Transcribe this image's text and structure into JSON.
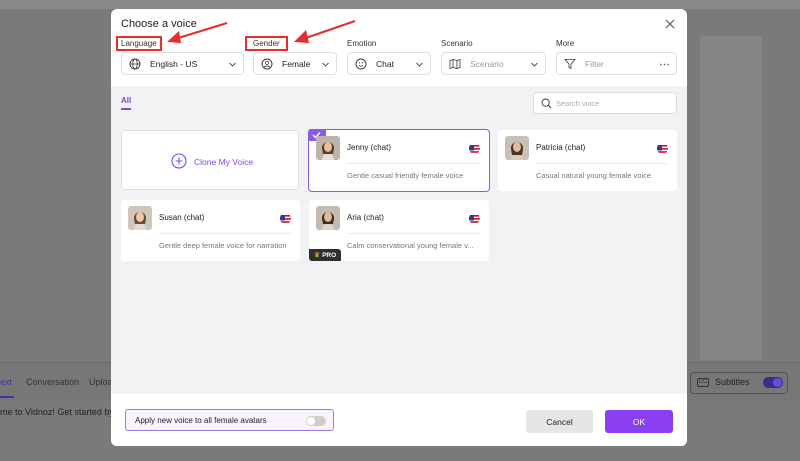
{
  "background": {
    "tabs": [
      "ext",
      "Conversation",
      "Uploa"
    ],
    "subtitles_label": "Subtitles",
    "subtitles_icon": "CC",
    "editor_text": "me to Vidnoz! Get started by ty"
  },
  "modal": {
    "title": "Choose a voice",
    "filters": {
      "language": {
        "label": "Language",
        "value": "English - US",
        "icon": "globe-icon"
      },
      "gender": {
        "label": "Gender",
        "value": "Female",
        "icon": "person-icon"
      },
      "emotion": {
        "label": "Emotion",
        "value": "Chat",
        "icon": "smiley-icon"
      },
      "scenario": {
        "label": "Scenario",
        "value": "Scenario",
        "icon": "map-icon"
      },
      "more": {
        "label": "More",
        "value": "Filter",
        "icon": "funnel-icon"
      }
    },
    "tab_all": "All",
    "search_placeholder": "Search voice",
    "clone_label": "Clone My Voice",
    "voices": [
      {
        "name": "Jenny (chat)",
        "desc": "Gentle casual friendly female voice",
        "selected": true,
        "pro": false
      },
      {
        "name": "Patricia (chat)",
        "desc": "Casual natural young female voice",
        "selected": false,
        "pro": false
      },
      {
        "name": "Susan (chat)",
        "desc": "Gentle deep female voice for narration",
        "selected": false,
        "pro": false
      },
      {
        "name": "Aria (chat)",
        "desc": "Calm conservational young female v...",
        "selected": false,
        "pro": true
      }
    ],
    "pro_badge": "PRO",
    "footer": {
      "apply_label": "Apply new voice to all female avatars",
      "apply_on": false,
      "cancel": "Cancel",
      "ok": "OK"
    }
  },
  "colors": {
    "accent": "#8a3ff0",
    "annotation": "#e03030"
  }
}
